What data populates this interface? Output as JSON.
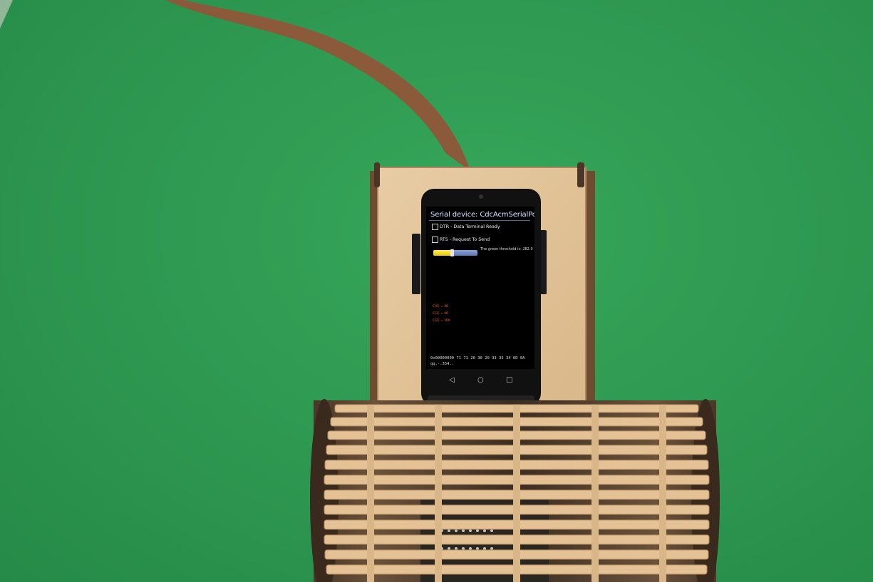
{
  "phone_screen": {
    "title": "Serial device: CdcAcmSerialPort",
    "options": [
      {
        "label": "DTR - Data Terminal Ready",
        "checked": false
      },
      {
        "label": "RTS - Request To Send",
        "checked": false
      }
    ],
    "threshold_text": "The green threshold is: 282.0",
    "camera_labels": [
      "C[0] = 46",
      "C[1] = 46",
      "C[2] = 100"
    ],
    "hex_line": "0x00000000 71 71 20 30 20 33 35 34 0D 0A",
    "ascii_line": "qq.-.354.."
  },
  "nav_icons": [
    "back-icon",
    "home-icon",
    "recents-icon"
  ],
  "colors": {
    "floor": "#2f9a52",
    "track": "#8a5a3a",
    "wood": "#e2c49a",
    "screen_title": "#d8e4ff",
    "slider_fill": "#f0d400"
  }
}
